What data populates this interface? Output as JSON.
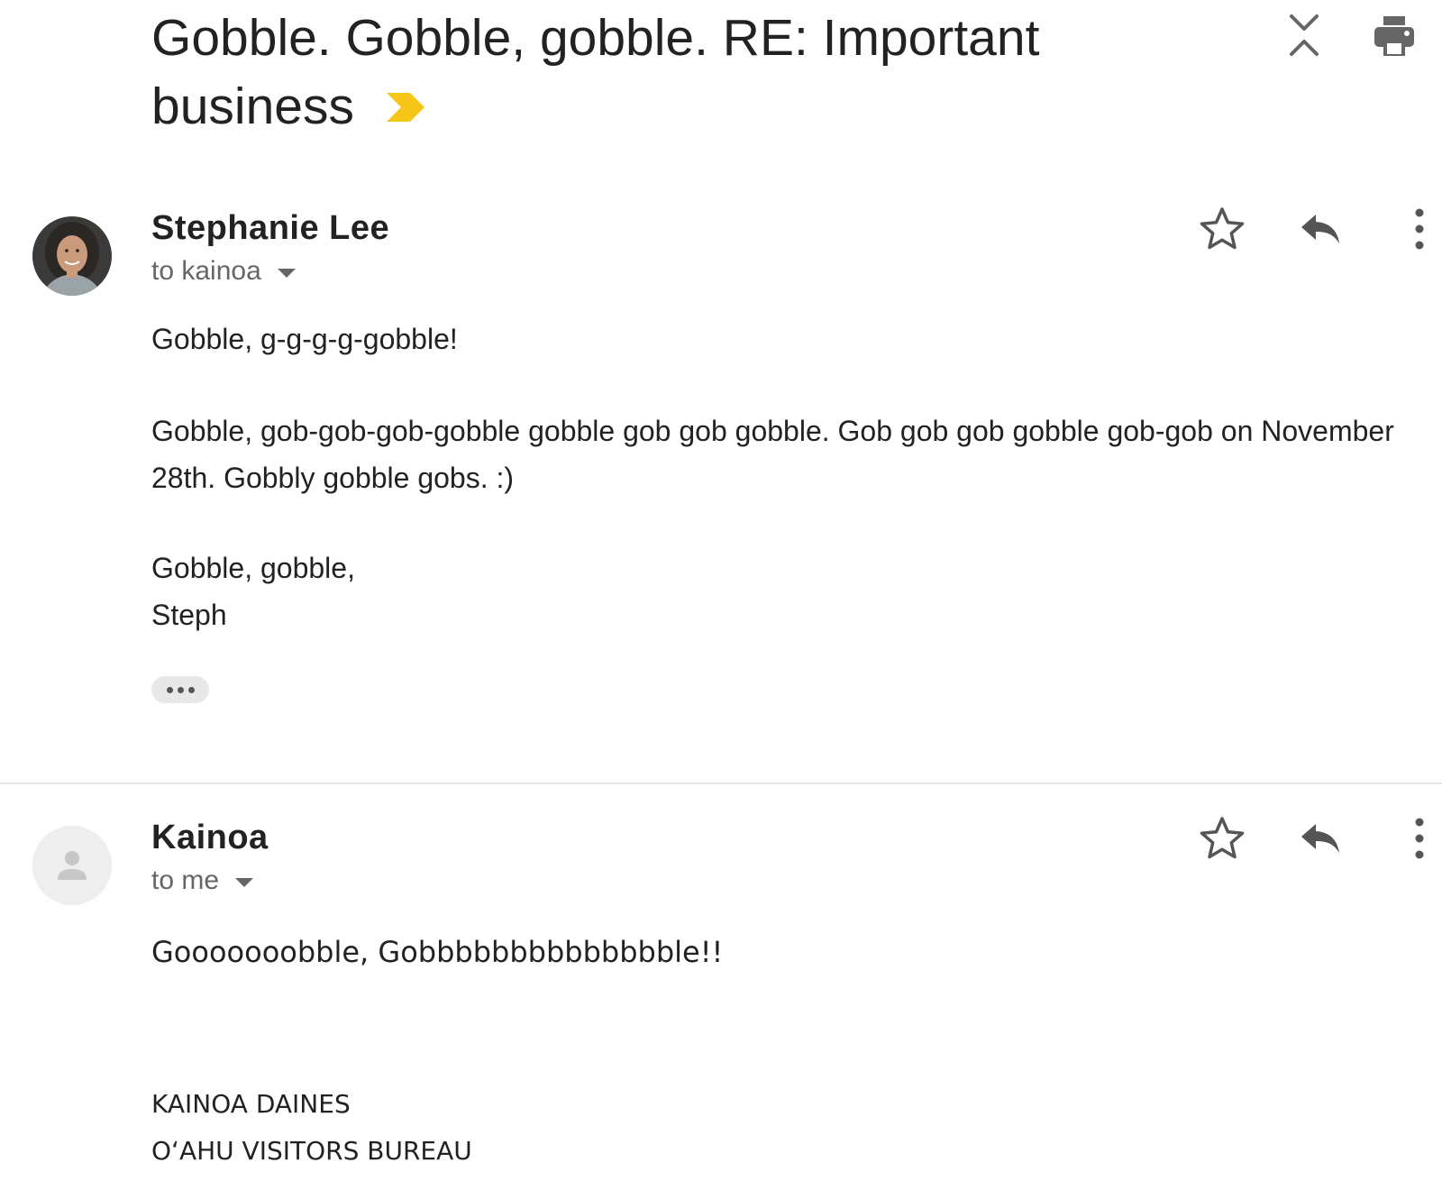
{
  "thread": {
    "subject": "Gobble. Gobble, gobble. RE: Important business",
    "important_color": "#F5C518"
  },
  "messages": [
    {
      "sender": "Stephanie Lee",
      "recipient": "to kainoa",
      "body": [
        "Gobble, g-g-g-g-gobble!",
        "Gobble, gob-gob-gob-gobble gobble gob gob gobble. Gob gob gob gobble gob-gob on November 28th. Gobbly gobble gobs. :)",
        "Gobble, gobble,",
        "Steph"
      ]
    },
    {
      "sender": "Kainoa",
      "recipient": "to me",
      "body": [
        "Gooooooobble, Gobbbbbbbbbbbbbble!!"
      ],
      "signature": [
        "KAINOA DAINES",
        "OʻAHU VISITORS BUREAU"
      ]
    }
  ],
  "icons": {
    "expand": "expand-all-icon",
    "print": "print-icon",
    "star": "star-icon",
    "reply": "reply-icon",
    "more": "more-vert-icon",
    "important": "important-marker-icon",
    "trimmed": "show-trimmed-content-icon"
  }
}
